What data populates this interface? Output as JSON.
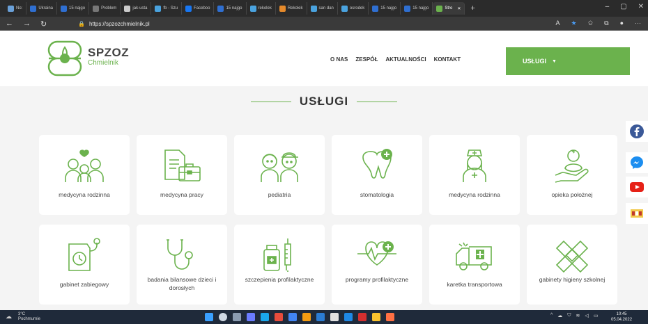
{
  "browser": {
    "tabs": [
      {
        "label": "No:",
        "color": "#6aa0d8"
      },
      {
        "label": "Ukraina",
        "color": "#2f6fd1"
      },
      {
        "label": "15 najgo",
        "color": "#2f6fd1"
      },
      {
        "label": "Problem",
        "color": "#777777"
      },
      {
        "label": "jak-usta",
        "color": "#cccccc"
      },
      {
        "label": "fb - Szu",
        "color": "#4aa3df"
      },
      {
        "label": "Faceboo",
        "color": "#1877f2"
      },
      {
        "label": "15 najgo",
        "color": "#2f6fd1"
      },
      {
        "label": "rekolek",
        "color": "#4aa3df"
      },
      {
        "label": "Rekolek",
        "color": "#e58a2b"
      },
      {
        "label": "san dan",
        "color": "#4aa3df"
      },
      {
        "label": "osrodek",
        "color": "#4aa3df"
      },
      {
        "label": "15 najgo",
        "color": "#2f6fd1"
      },
      {
        "label": "15 najgo",
        "color": "#2f6fd1"
      },
      {
        "label": "Stro",
        "color": "#6bb24d",
        "active": true
      }
    ],
    "url": "https://spzozchmielnik.pl"
  },
  "site": {
    "logo_title": "SPZOZ",
    "logo_subtitle": "Chmielnik",
    "nav": [
      "O NAS",
      "ZESPÓŁ",
      "AKTUALNOŚCI",
      "KONTAKT"
    ],
    "services_button": "USŁUGI",
    "section_title": "USŁUGI",
    "accent_color": "#6bb24d",
    "services": [
      {
        "label": "medycyna rodzinna",
        "icon": "family-icon"
      },
      {
        "label": "medycyna pracy",
        "icon": "documents-briefcase-icon"
      },
      {
        "label": "pediatria",
        "icon": "children-icon"
      },
      {
        "label": "stomatologia",
        "icon": "tooth-icon"
      },
      {
        "label": "medycyna rodzinna",
        "icon": "nurse-icon"
      },
      {
        "label": "opieka położnej",
        "icon": "baby-hand-icon"
      },
      {
        "label": "gabinet zabiegowy",
        "icon": "blood-pressure-icon"
      },
      {
        "label": "badania bilansowe dzieci i dorosłych",
        "icon": "stethoscope-icon"
      },
      {
        "label": "szczepienia profilaktyczne",
        "icon": "vaccine-icon"
      },
      {
        "label": "programy profilaktyczne",
        "icon": "heartbeat-icon"
      },
      {
        "label": "karetka transportowa",
        "icon": "ambulance-icon"
      },
      {
        "label": "gabinety higieny szkolnej",
        "icon": "bandage-icon"
      }
    ]
  },
  "taskbar": {
    "weather_temp": "3°C",
    "weather_desc": "Pochmurnie",
    "time": "10:45",
    "date": "05.04.2022"
  }
}
